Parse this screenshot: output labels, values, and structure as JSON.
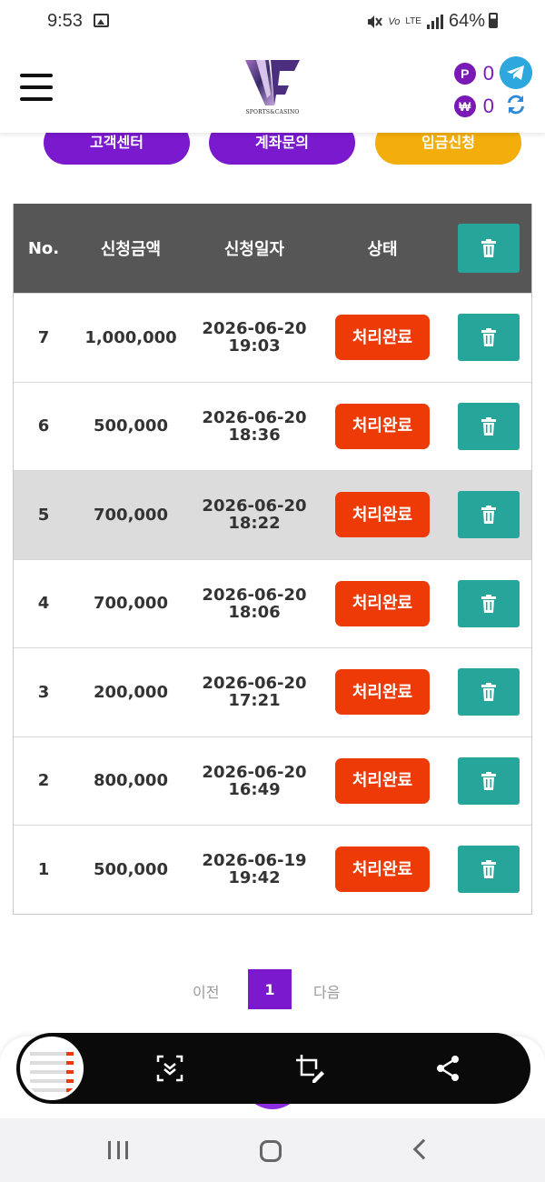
{
  "status_bar": {
    "time": "9:53",
    "carrier_icon": "Vo",
    "lte_label": "LTE",
    "battery": "64%"
  },
  "header": {
    "logo_text": "SPORTS&CASINO",
    "point_symbol": "P",
    "point_value": "0",
    "won_symbol": "₩",
    "won_value": "0"
  },
  "top_buttons": [
    "고객센터",
    "계좌문의",
    "입금신청"
  ],
  "colors": {
    "purple": "#7a19cd",
    "status_red": "#ee3a06",
    "teal": "#26a69a",
    "header_gray": "#565656",
    "yellow": "#f4ae0b"
  },
  "table": {
    "headers": {
      "no": "No.",
      "amount": "신청금액",
      "date": "신청일자",
      "status": "상태"
    },
    "rows": [
      {
        "no": "7",
        "amount": "1,000,000",
        "date": "2026-06-20",
        "time": "19:03",
        "status": "처리완료"
      },
      {
        "no": "6",
        "amount": "500,000",
        "date": "2026-06-20",
        "time": "18:36",
        "status": "처리완료"
      },
      {
        "no": "5",
        "amount": "700,000",
        "date": "2026-06-20",
        "time": "18:22",
        "status": "처리완료"
      },
      {
        "no": "4",
        "amount": "700,000",
        "date": "2026-06-20",
        "time": "18:06",
        "status": "처리완료"
      },
      {
        "no": "3",
        "amount": "200,000",
        "date": "2026-06-20",
        "time": "17:21",
        "status": "처리완료"
      },
      {
        "no": "2",
        "amount": "800,000",
        "date": "2026-06-20",
        "time": "16:49",
        "status": "처리완료"
      },
      {
        "no": "1",
        "amount": "500,000",
        "date": "2026-06-19",
        "time": "19:42",
        "status": "처리완료"
      }
    ]
  },
  "pagination": {
    "prev": "이전",
    "current": "1",
    "next": "다음"
  }
}
